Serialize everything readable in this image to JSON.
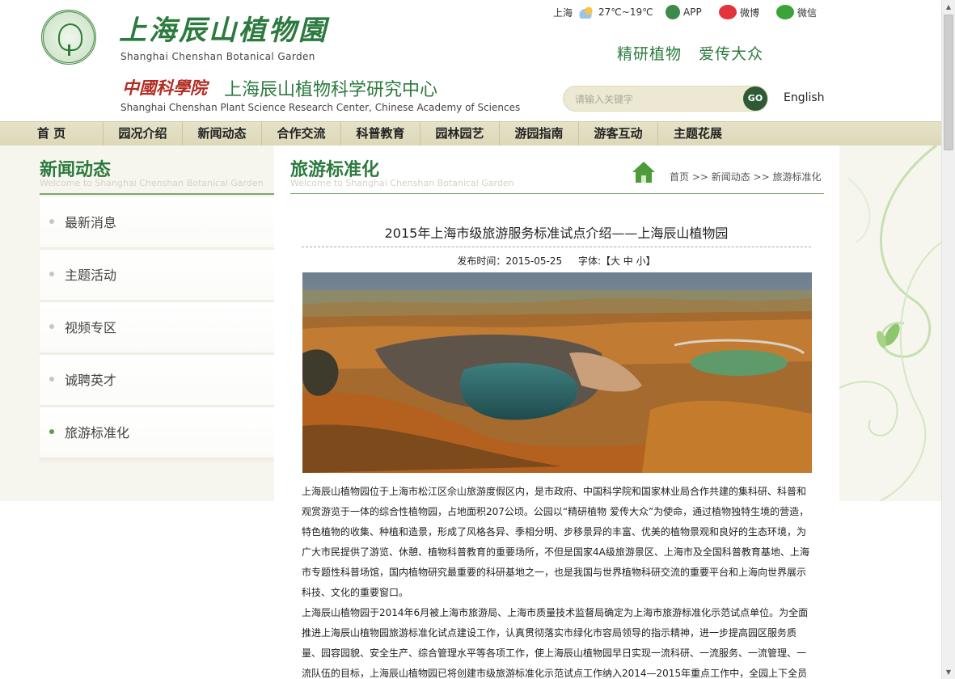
{
  "header": {
    "site_title_cn": "上海辰山植物園",
    "site_title_en": "Shanghai  Chenshan  Botanical  Garden",
    "cas_logo_text": "中國科學院",
    "center_title_cn": "上海辰山植物科学研究中心",
    "center_title_en": "Shanghai Chenshan Plant Science Research Center, Chinese Academy of Sciences",
    "weather_city": "上海",
    "weather_temp": "27℃~19℃",
    "app_label": "APP",
    "weibo_label": "微博",
    "wechat_label": "微信",
    "slogan": "精研植物   爱传大众",
    "search_placeholder": "请输入关键字",
    "search_button": "GO",
    "language_link": "English"
  },
  "nav": {
    "items": [
      "首 页",
      "园况介绍",
      "新闻动态",
      "合作交流",
      "科普教育",
      "园林园艺",
      "游园指南",
      "游客互动",
      "主题花展"
    ]
  },
  "sidebar": {
    "title": "新闻动态",
    "subtitle": "Welcome to Shanghai Chenshan Botanical Garden",
    "items": [
      {
        "label": "最新消息",
        "active": false
      },
      {
        "label": "主题活动",
        "active": false
      },
      {
        "label": "视频专区",
        "active": false
      },
      {
        "label": "诚聘英才",
        "active": false
      },
      {
        "label": "旅游标准化",
        "active": true
      }
    ]
  },
  "main": {
    "title": "旅游标准化",
    "subtitle": "Welcome to Shanghai Chenshan Botanical Garden",
    "breadcrumb": "首页 >> 新闻动态 >> 旅游标准化"
  },
  "article": {
    "title": "2015年上海市级旅游服务标准试点介绍——上海辰山植物园",
    "publish_label": "发布时间：2015-05-25",
    "font_label": "字体:【大 中 小】",
    "paragraphs": [
      "上海辰山植物园位于上海市松江区佘山旅游度假区内，是市政府、中国科学院和国家林业局合作共建的集科研、科普和观赏游览于一体的综合性植物园，占地面积207公顷。公园以“精研植物 爱传大众”为使命，通过植物独特生境的营造，特色植物的收集、种植和造景，形成了风格各异、季相分明、步移景异的丰富、优美的植物景观和良好的生态环境，为广大市民提供了游览、休憩、植物科普教育的重要场所，不但是国家4A级旅游景区、上海市及全国科普教育基地、上海市专题性科普场馆，国内植物研究最重要的科研基地之一，也是我国与世界植物科研交流的重要平台和上海向世界展示科技、文化的重要窗口。",
      "上海辰山植物园于2014年6月被上海市旅游局、上海市质量技术监督局确定为上海市旅游标准化示范试点单位。为全面推进上海辰山植物园旅游标准化试点建设工作，认真贯彻落实市绿化市容局领导的指示精神，进一步提高园区服务质量、园容园貌、安全生产、综合管理水平等各项工作，使上海辰山植物园早日实现一流科研、一流服务、一流管理、一流队伍的目标，上海辰山植物园已将创建市级旅游标准化示范试点工作纳入2014—2015年重点工作中，全园上下全员"
    ]
  }
}
